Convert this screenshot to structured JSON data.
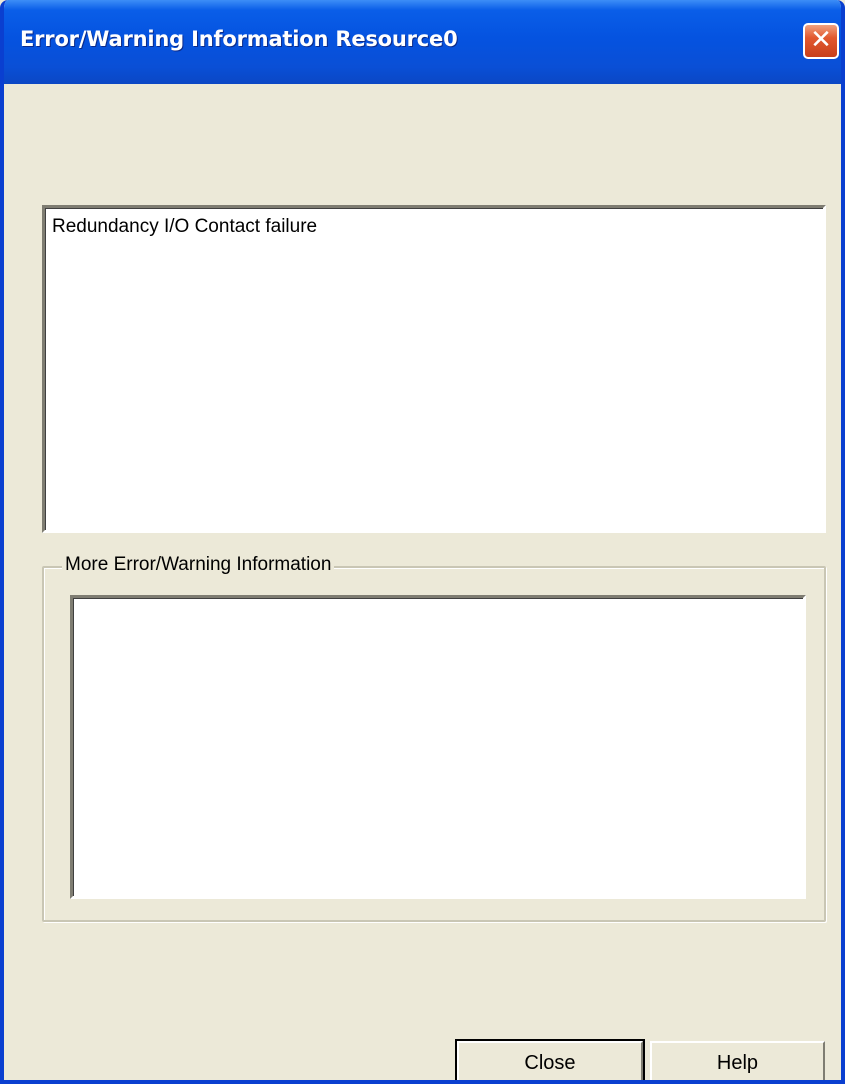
{
  "window": {
    "title": "Error/Warning Information Resource0",
    "close_glyph": "✕",
    "title_bar_color": "#0553e0",
    "close_button_color": "#e2582f"
  },
  "message": {
    "text": "Redundancy I/O Contact failure"
  },
  "more_info": {
    "label": "More Error/Warning Information",
    "text": ""
  },
  "buttons": {
    "close_label": "Close",
    "help_label": "Help"
  }
}
